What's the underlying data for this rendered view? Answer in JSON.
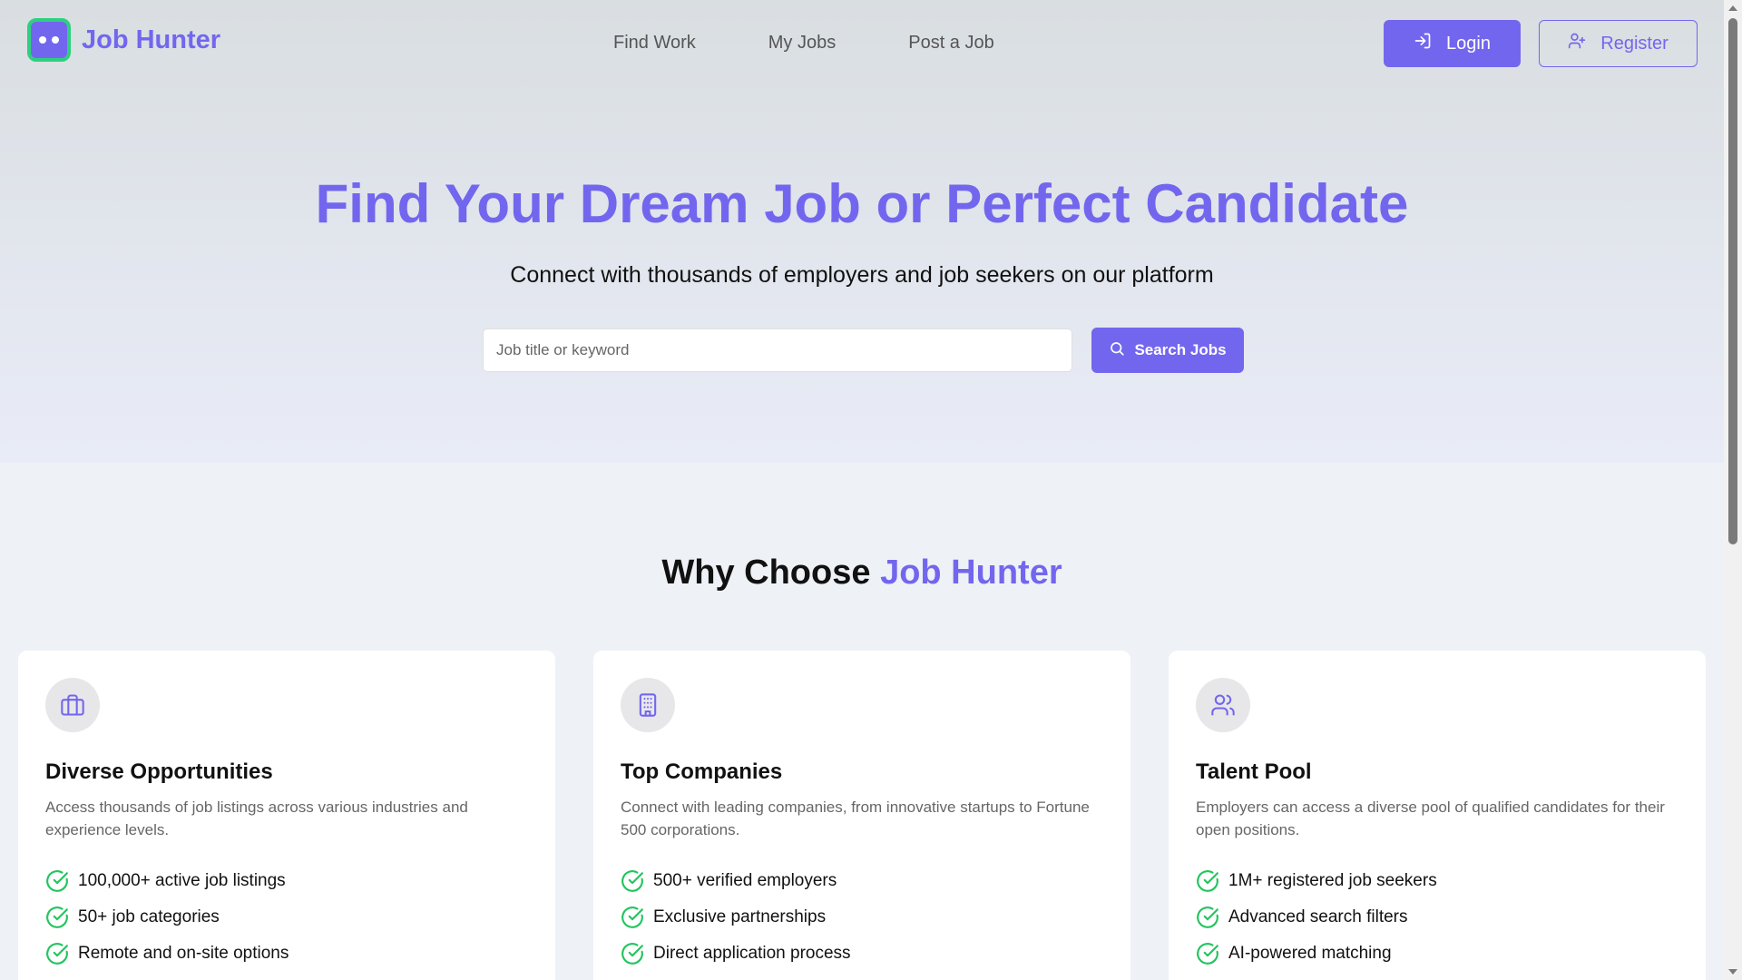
{
  "header": {
    "logo_text": "Job Hunter",
    "nav": [
      "Find Work",
      "My Jobs",
      "Post a Job"
    ],
    "login_label": "Login",
    "register_label": "Register"
  },
  "hero": {
    "title": "Find Your Dream Job or Perfect Candidate",
    "subtitle": "Connect with thousands of employers and job seekers on our platform",
    "search_placeholder": "Job title or keyword",
    "search_value": "",
    "search_button": "Search Jobs"
  },
  "why": {
    "title_prefix": "Why Choose",
    "title_accent": "Job Hunter"
  },
  "cards": [
    {
      "icon": "briefcase-icon",
      "title": "Diverse Opportunities",
      "description": "Access thousands of job listings across various industries and experience levels.",
      "features": [
        "100,000+ active job listings",
        "50+ job categories",
        "Remote and on-site options"
      ]
    },
    {
      "icon": "building-icon",
      "title": "Top Companies",
      "description": "Connect with leading companies, from innovative startups to Fortune 500 corporations.",
      "features": [
        "500+ verified employers",
        "Exclusive partnerships",
        "Direct application process"
      ]
    },
    {
      "icon": "users-icon",
      "title": "Talent Pool",
      "description": "Employers can access a diverse pool of qualified candidates for their open positions.",
      "features": [
        "1M+ registered job seekers",
        "Advanced search filters",
        "AI-powered matching"
      ]
    }
  ],
  "colors": {
    "brand": "#7366ee",
    "logo_border": "#2ed07f",
    "check": "#22c55e"
  }
}
